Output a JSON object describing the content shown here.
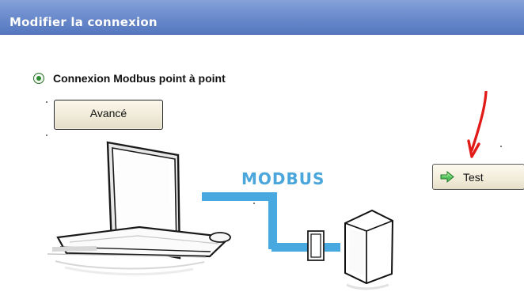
{
  "window": {
    "title": "Modifier la connexion"
  },
  "connection": {
    "radio_label": "Connexion Modbus point à point",
    "selected": true
  },
  "buttons": {
    "advanced_label": "Avancé",
    "test_label": "Test"
  },
  "diagram": {
    "protocol_label": "MODBUS"
  },
  "colors": {
    "titlebar": "#6f8fcf",
    "modbus_cable": "#48a8e0",
    "annotation_arrow": "#e11b18",
    "test_icon": "#57c35d"
  },
  "icons": {
    "radio": "radio-selected-icon",
    "test": "green-arrow-right-icon",
    "annotation": "red-arrow-icon",
    "computer": "computer-icon",
    "device": "modbus-device-icon"
  }
}
